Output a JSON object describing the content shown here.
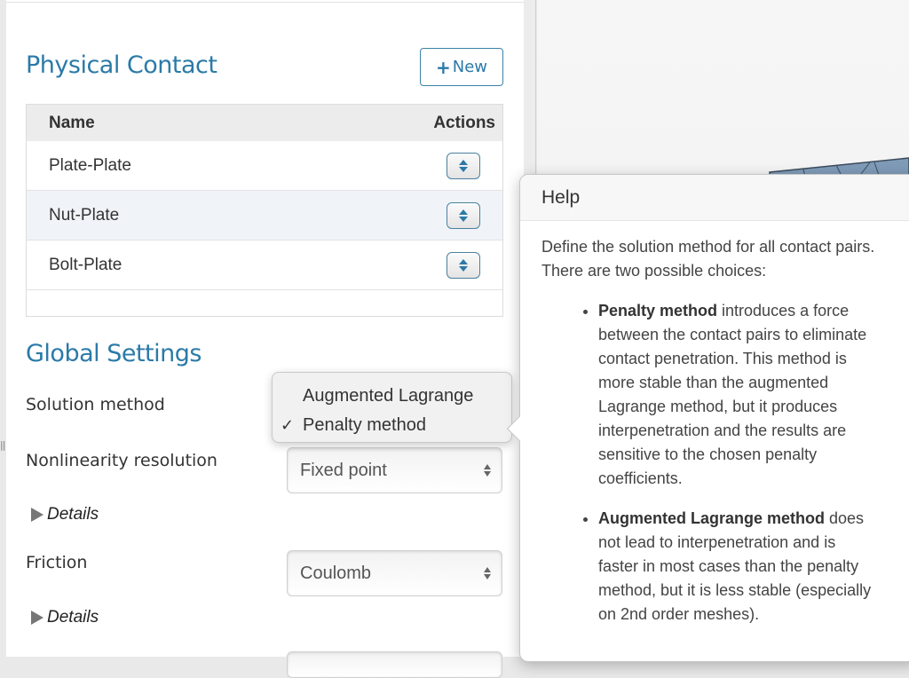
{
  "physical_contact": {
    "title": "Physical Contact",
    "new_button": {
      "icon": "plus-icon",
      "label": "New"
    },
    "table": {
      "columns": [
        "Name",
        "Actions"
      ],
      "rows": [
        {
          "name": "Plate-Plate",
          "action_icon": "up-down-arrows-icon"
        },
        {
          "name": "Nut-Plate",
          "action_icon": "up-down-arrows-icon"
        },
        {
          "name": "Bolt-Plate",
          "action_icon": "up-down-arrows-icon"
        }
      ]
    }
  },
  "global_settings": {
    "title": "Global Settings",
    "solution_method": {
      "label": "Solution method",
      "options": [
        "Augmented Lagrange",
        "Penalty method"
      ],
      "selected": "Penalty method",
      "check": "✓"
    },
    "nonlinearity_resolution": {
      "label": "Nonlinearity resolution",
      "value": "Fixed point"
    },
    "details_label": "Details",
    "friction": {
      "label": "Friction",
      "value": "Coulomb"
    }
  },
  "help": {
    "title": "Help",
    "intro": "Define the solution method for all contact pairs. There are two possible choices:",
    "items": [
      {
        "term": "Penalty method",
        "text": " introduces a force between the contact pairs to eliminate contact penetration. This method is more stable than the augmented Lagrange method, but it produces interpenetration and the results are sensitive to the chosen penalty coefficients."
      },
      {
        "term": "Augmented Lagrange method",
        "text": " does not lead to interpenetration and is faster in most cases than the penalty method, but it is less stable (especially on 2nd order meshes)."
      }
    ]
  },
  "colors": {
    "accent": "#2b7aa8",
    "mesh": "#7f9bb8"
  }
}
